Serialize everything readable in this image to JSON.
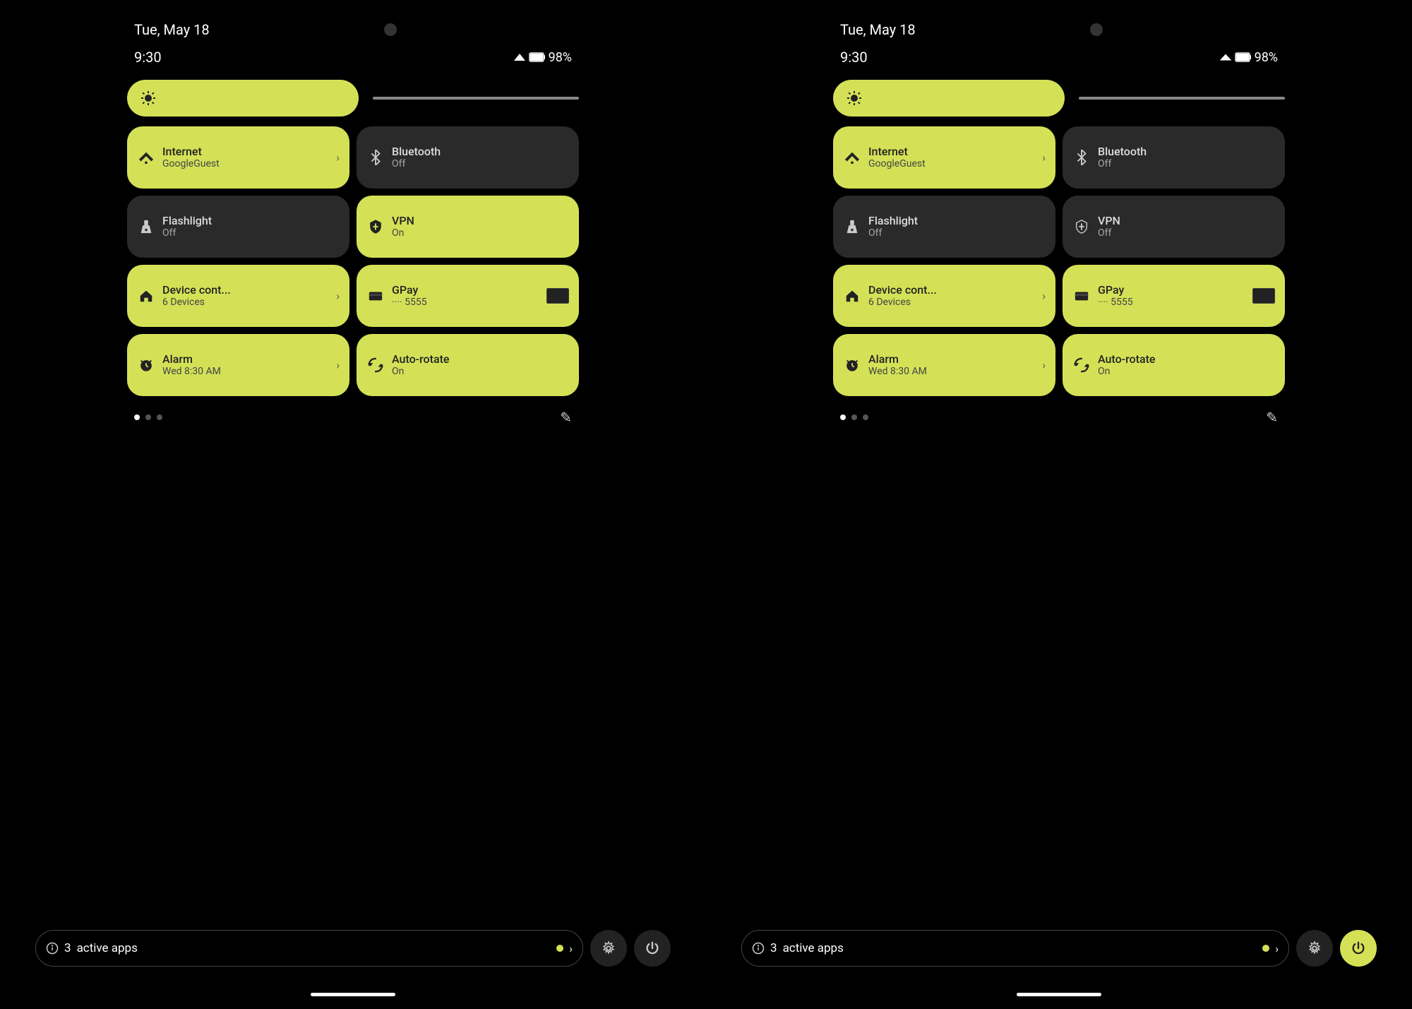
{
  "screens": [
    {
      "id": "screen-left",
      "statusBar": {
        "date": "Tue, May 18",
        "time": "9:30",
        "battery": "98%"
      },
      "brightness": {
        "label": "brightness-slider"
      },
      "tiles": [
        {
          "id": "internet",
          "title": "Internet",
          "subtitle": "GoogleGuest",
          "active": true,
          "hasArrow": true,
          "icon": "wifi"
        },
        {
          "id": "bluetooth",
          "title": "Bluetooth",
          "subtitle": "Off",
          "active": false,
          "hasArrow": false,
          "icon": "bluetooth"
        },
        {
          "id": "flashlight",
          "title": "Flashlight",
          "subtitle": "Off",
          "active": false,
          "hasArrow": false,
          "icon": "flashlight"
        },
        {
          "id": "vpn",
          "title": "VPN",
          "subtitle": "On",
          "active": true,
          "hasArrow": false,
          "icon": "vpn"
        },
        {
          "id": "device-controls",
          "title": "Device cont...",
          "subtitle": "6 Devices",
          "active": true,
          "hasArrow": true,
          "icon": "home"
        },
        {
          "id": "gpay",
          "title": "GPay",
          "subtitle": "···· 5555",
          "active": true,
          "hasArrow": false,
          "hasCard": true,
          "icon": "card"
        },
        {
          "id": "alarm",
          "title": "Alarm",
          "subtitle": "Wed 8:30 AM",
          "active": true,
          "hasArrow": true,
          "icon": "alarm"
        },
        {
          "id": "autorotate",
          "title": "Auto-rotate",
          "subtitle": "On",
          "active": true,
          "hasArrow": false,
          "icon": "rotate"
        }
      ],
      "dots": [
        true,
        false,
        false
      ],
      "activeApps": {
        "count": "3",
        "label": "active apps"
      },
      "bottomButtons": {
        "settings": "⚙",
        "power": "⏻",
        "powerActive": false
      }
    },
    {
      "id": "screen-right",
      "statusBar": {
        "date": "Tue, May 18",
        "time": "9:30",
        "battery": "98%"
      },
      "brightness": {
        "label": "brightness-slider"
      },
      "tiles": [
        {
          "id": "internet",
          "title": "Internet",
          "subtitle": "GoogleGuest",
          "active": true,
          "hasArrow": true,
          "icon": "wifi"
        },
        {
          "id": "bluetooth",
          "title": "Bluetooth",
          "subtitle": "Off",
          "active": false,
          "hasArrow": false,
          "icon": "bluetooth"
        },
        {
          "id": "flashlight",
          "title": "Flashlight",
          "subtitle": "Off",
          "active": false,
          "hasArrow": false,
          "icon": "flashlight"
        },
        {
          "id": "vpn",
          "title": "VPN",
          "subtitle": "Off",
          "active": false,
          "hasArrow": false,
          "icon": "vpn"
        },
        {
          "id": "device-controls",
          "title": "Device cont...",
          "subtitle": "6 Devices",
          "active": true,
          "hasArrow": true,
          "icon": "home"
        },
        {
          "id": "gpay",
          "title": "GPay",
          "subtitle": "···· 5555",
          "active": true,
          "hasArrow": false,
          "hasCard": true,
          "icon": "card"
        },
        {
          "id": "alarm",
          "title": "Alarm",
          "subtitle": "Wed 8:30 AM",
          "active": true,
          "hasArrow": true,
          "icon": "alarm"
        },
        {
          "id": "autorotate",
          "title": "Auto-rotate",
          "subtitle": "On",
          "active": true,
          "hasArrow": false,
          "icon": "rotate"
        }
      ],
      "dots": [
        true,
        false,
        false
      ],
      "activeApps": {
        "count": "3",
        "label": "active apps"
      },
      "bottomButtons": {
        "settings": "⚙",
        "power": "⏻",
        "powerActive": true
      }
    }
  ],
  "icons": {
    "wifi": "▼",
    "bluetooth": "✱",
    "flashlight": "🔦",
    "vpn": "🛡",
    "home": "⌂",
    "card": "💳",
    "alarm": "⏰",
    "rotate": "↻",
    "settings": "⚙",
    "power": "⏻",
    "info": "ℹ",
    "edit": "✎",
    "brightness": "✺",
    "chevron": "›"
  },
  "accentColor": "#d4e157",
  "inactiveColor": "#2a2a2a"
}
